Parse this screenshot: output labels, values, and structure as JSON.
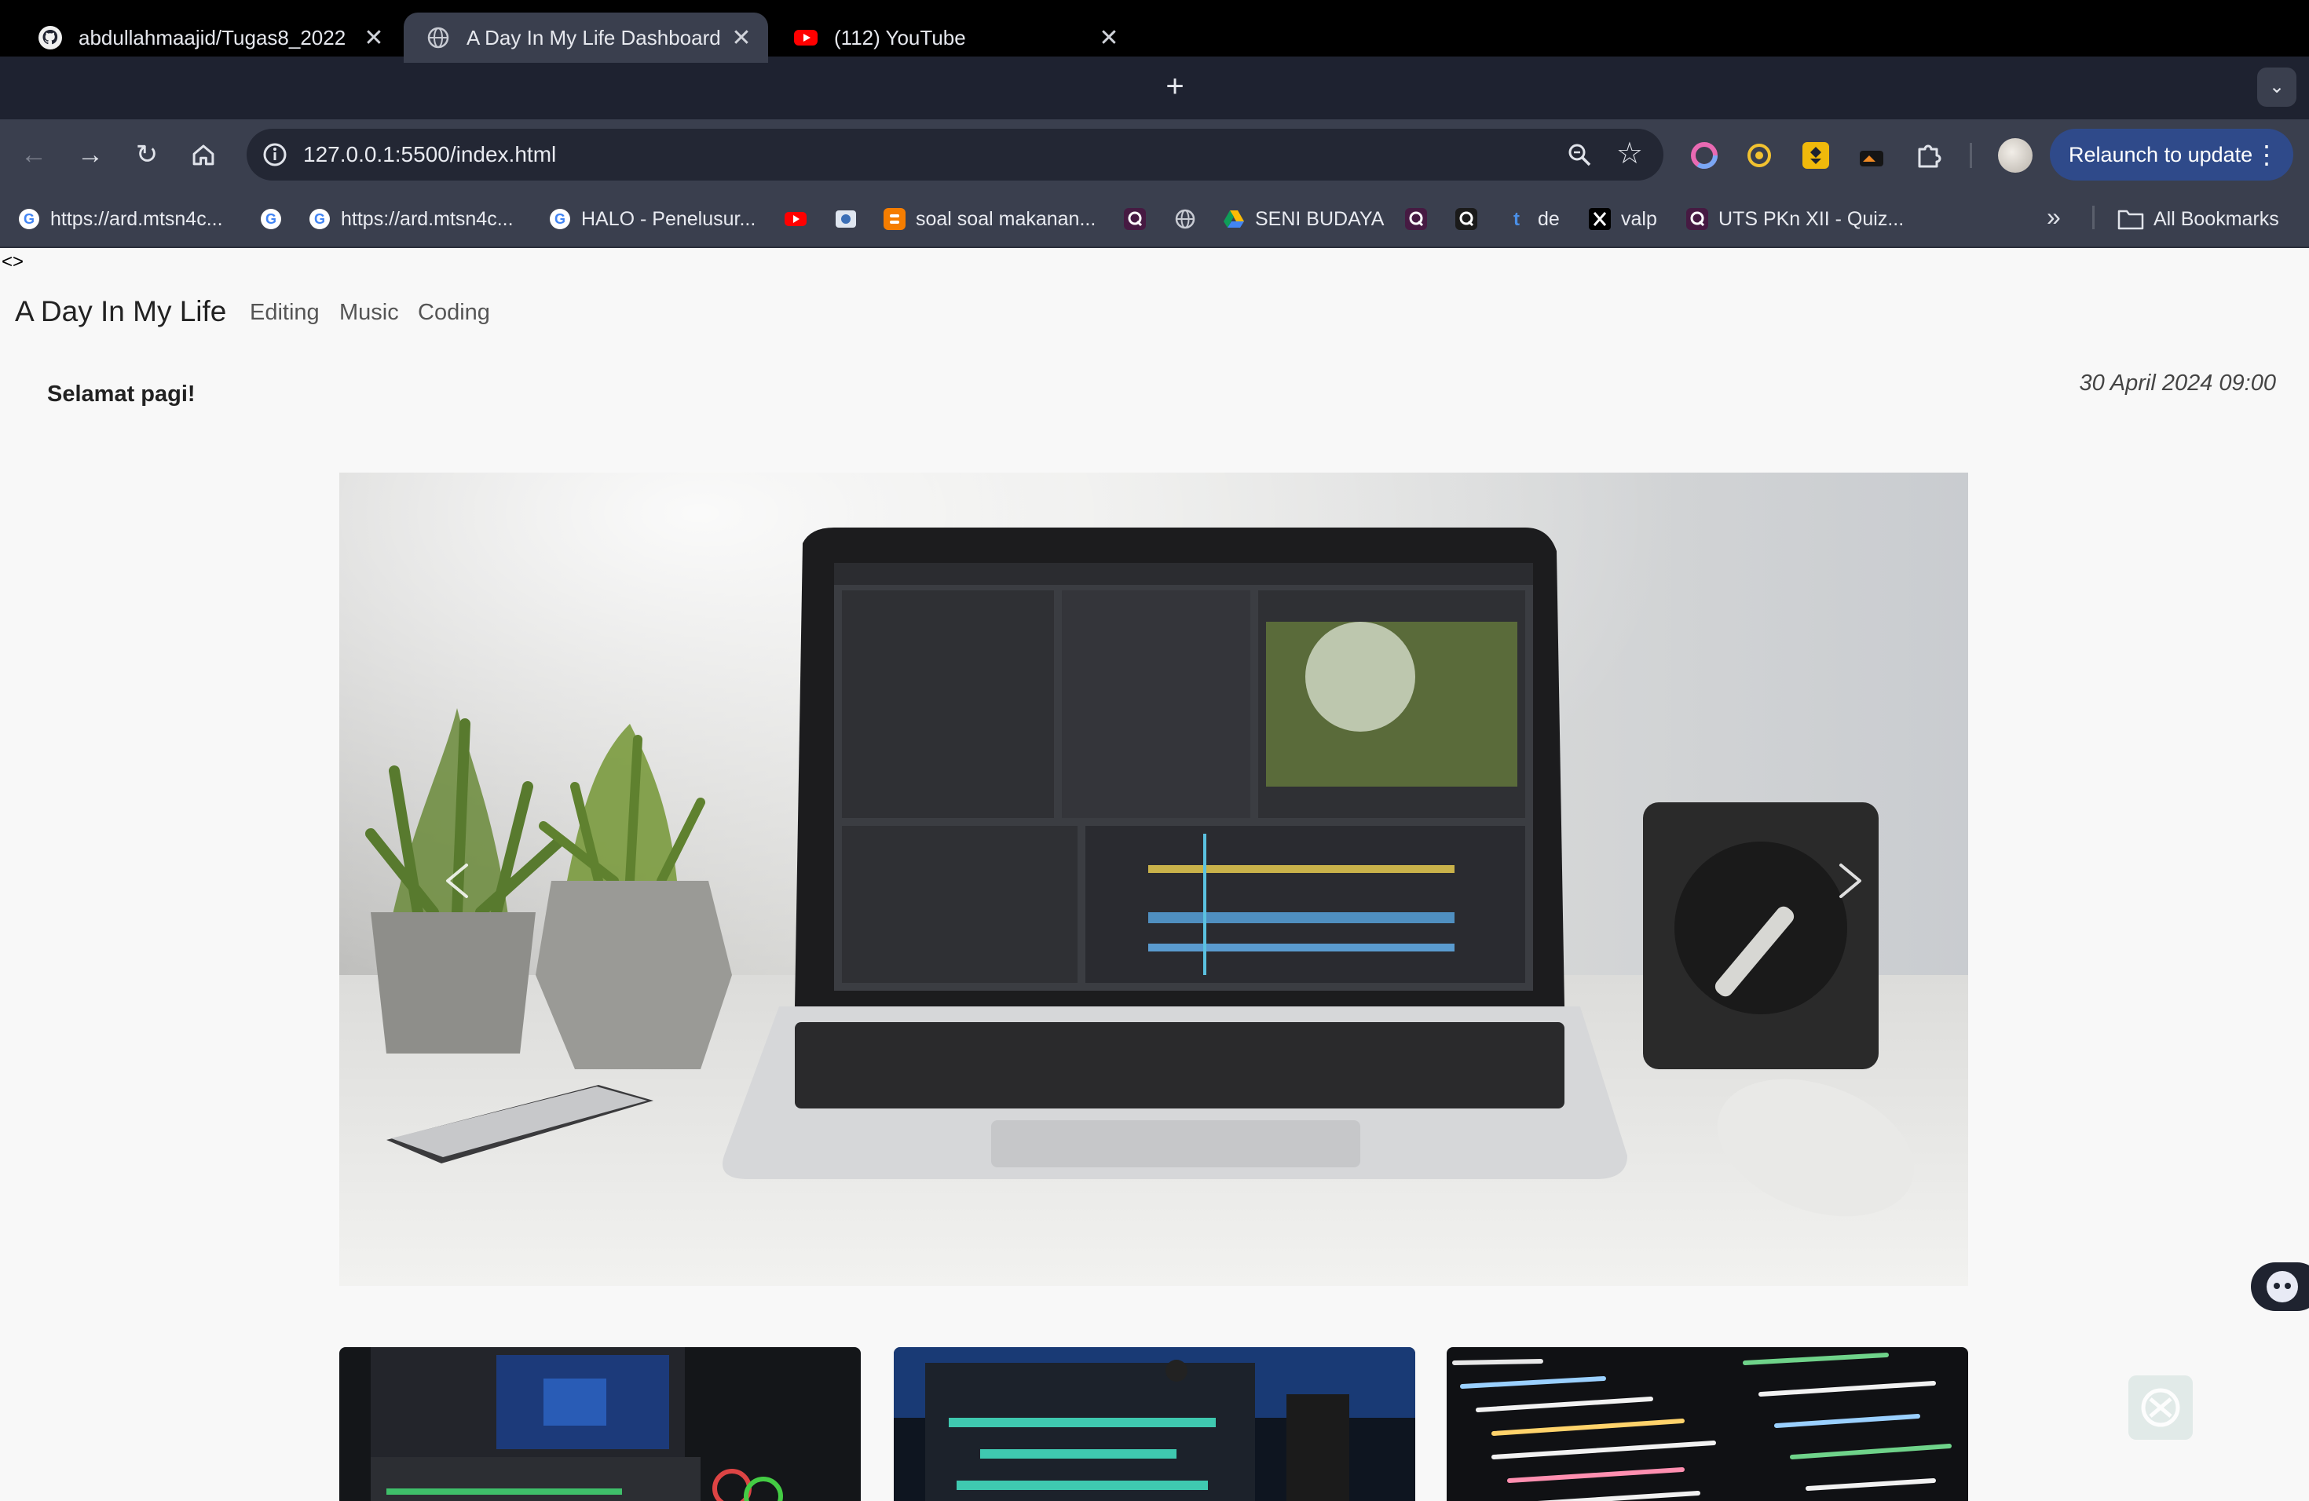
{
  "browser": {
    "tabs": [
      {
        "title": "abdullahmaajid/Tugas8_2022",
        "icon": "github-icon",
        "active": false
      },
      {
        "title": "A Day In My Life Dashboard",
        "icon": "globe-icon",
        "active": true
      },
      {
        "title": "(112) YouTube",
        "icon": "youtube-icon",
        "active": false
      }
    ],
    "address_url": "127.0.0.1:5500/index.html",
    "relaunch_label": "Relaunch to update",
    "bookmarks": [
      {
        "label": "https://ard.mtsn4c...",
        "icon": "google-icon"
      },
      {
        "label": "",
        "icon": "google-icon"
      },
      {
        "label": "https://ard.mtsn4c...",
        "icon": "google-icon"
      },
      {
        "label": "HALO - Penelusur...",
        "icon": "google-icon"
      },
      {
        "label": "",
        "icon": "youtube-icon"
      },
      {
        "label": "",
        "icon": "site-icon"
      },
      {
        "label": "soal soal makanan...",
        "icon": "blogger-icon"
      },
      {
        "label": "",
        "icon": "quizizz-icon"
      },
      {
        "label": "",
        "icon": "globe-icon"
      },
      {
        "label": "SENI BUDAYA",
        "icon": "google-drive-icon"
      },
      {
        "label": "",
        "icon": "quizizz-icon"
      },
      {
        "label": "",
        "icon": "quizizz-icon"
      },
      {
        "label": "de",
        "icon": "tumblr-icon"
      },
      {
        "label": "valp",
        "icon": "x-icon"
      },
      {
        "label": "UTS PKn XII - Quiz...",
        "icon": "quizizz-icon"
      }
    ],
    "all_bookmarks_label": "All Bookmarks"
  },
  "page": {
    "stray_text": "<>",
    "brand": "A Day In My Life",
    "nav": [
      "Editing",
      "Music",
      "Coding"
    ],
    "greeting": "Selamat pagi!",
    "datetime": "30 April 2024 09:00",
    "carousel": {
      "slide_subject": "laptop-video-editing-photo"
    },
    "cards": [
      {
        "subject": "video-editing-photo"
      },
      {
        "subject": "music-production-photo"
      },
      {
        "subject": "code-editor-photo"
      }
    ]
  },
  "colors": {
    "titlebar": "#000000",
    "tabstrip": "#1e2230",
    "toolbar": "#3a3f4e",
    "relaunch": "#2f4a8a",
    "page_bg": "#f8f8f8"
  }
}
